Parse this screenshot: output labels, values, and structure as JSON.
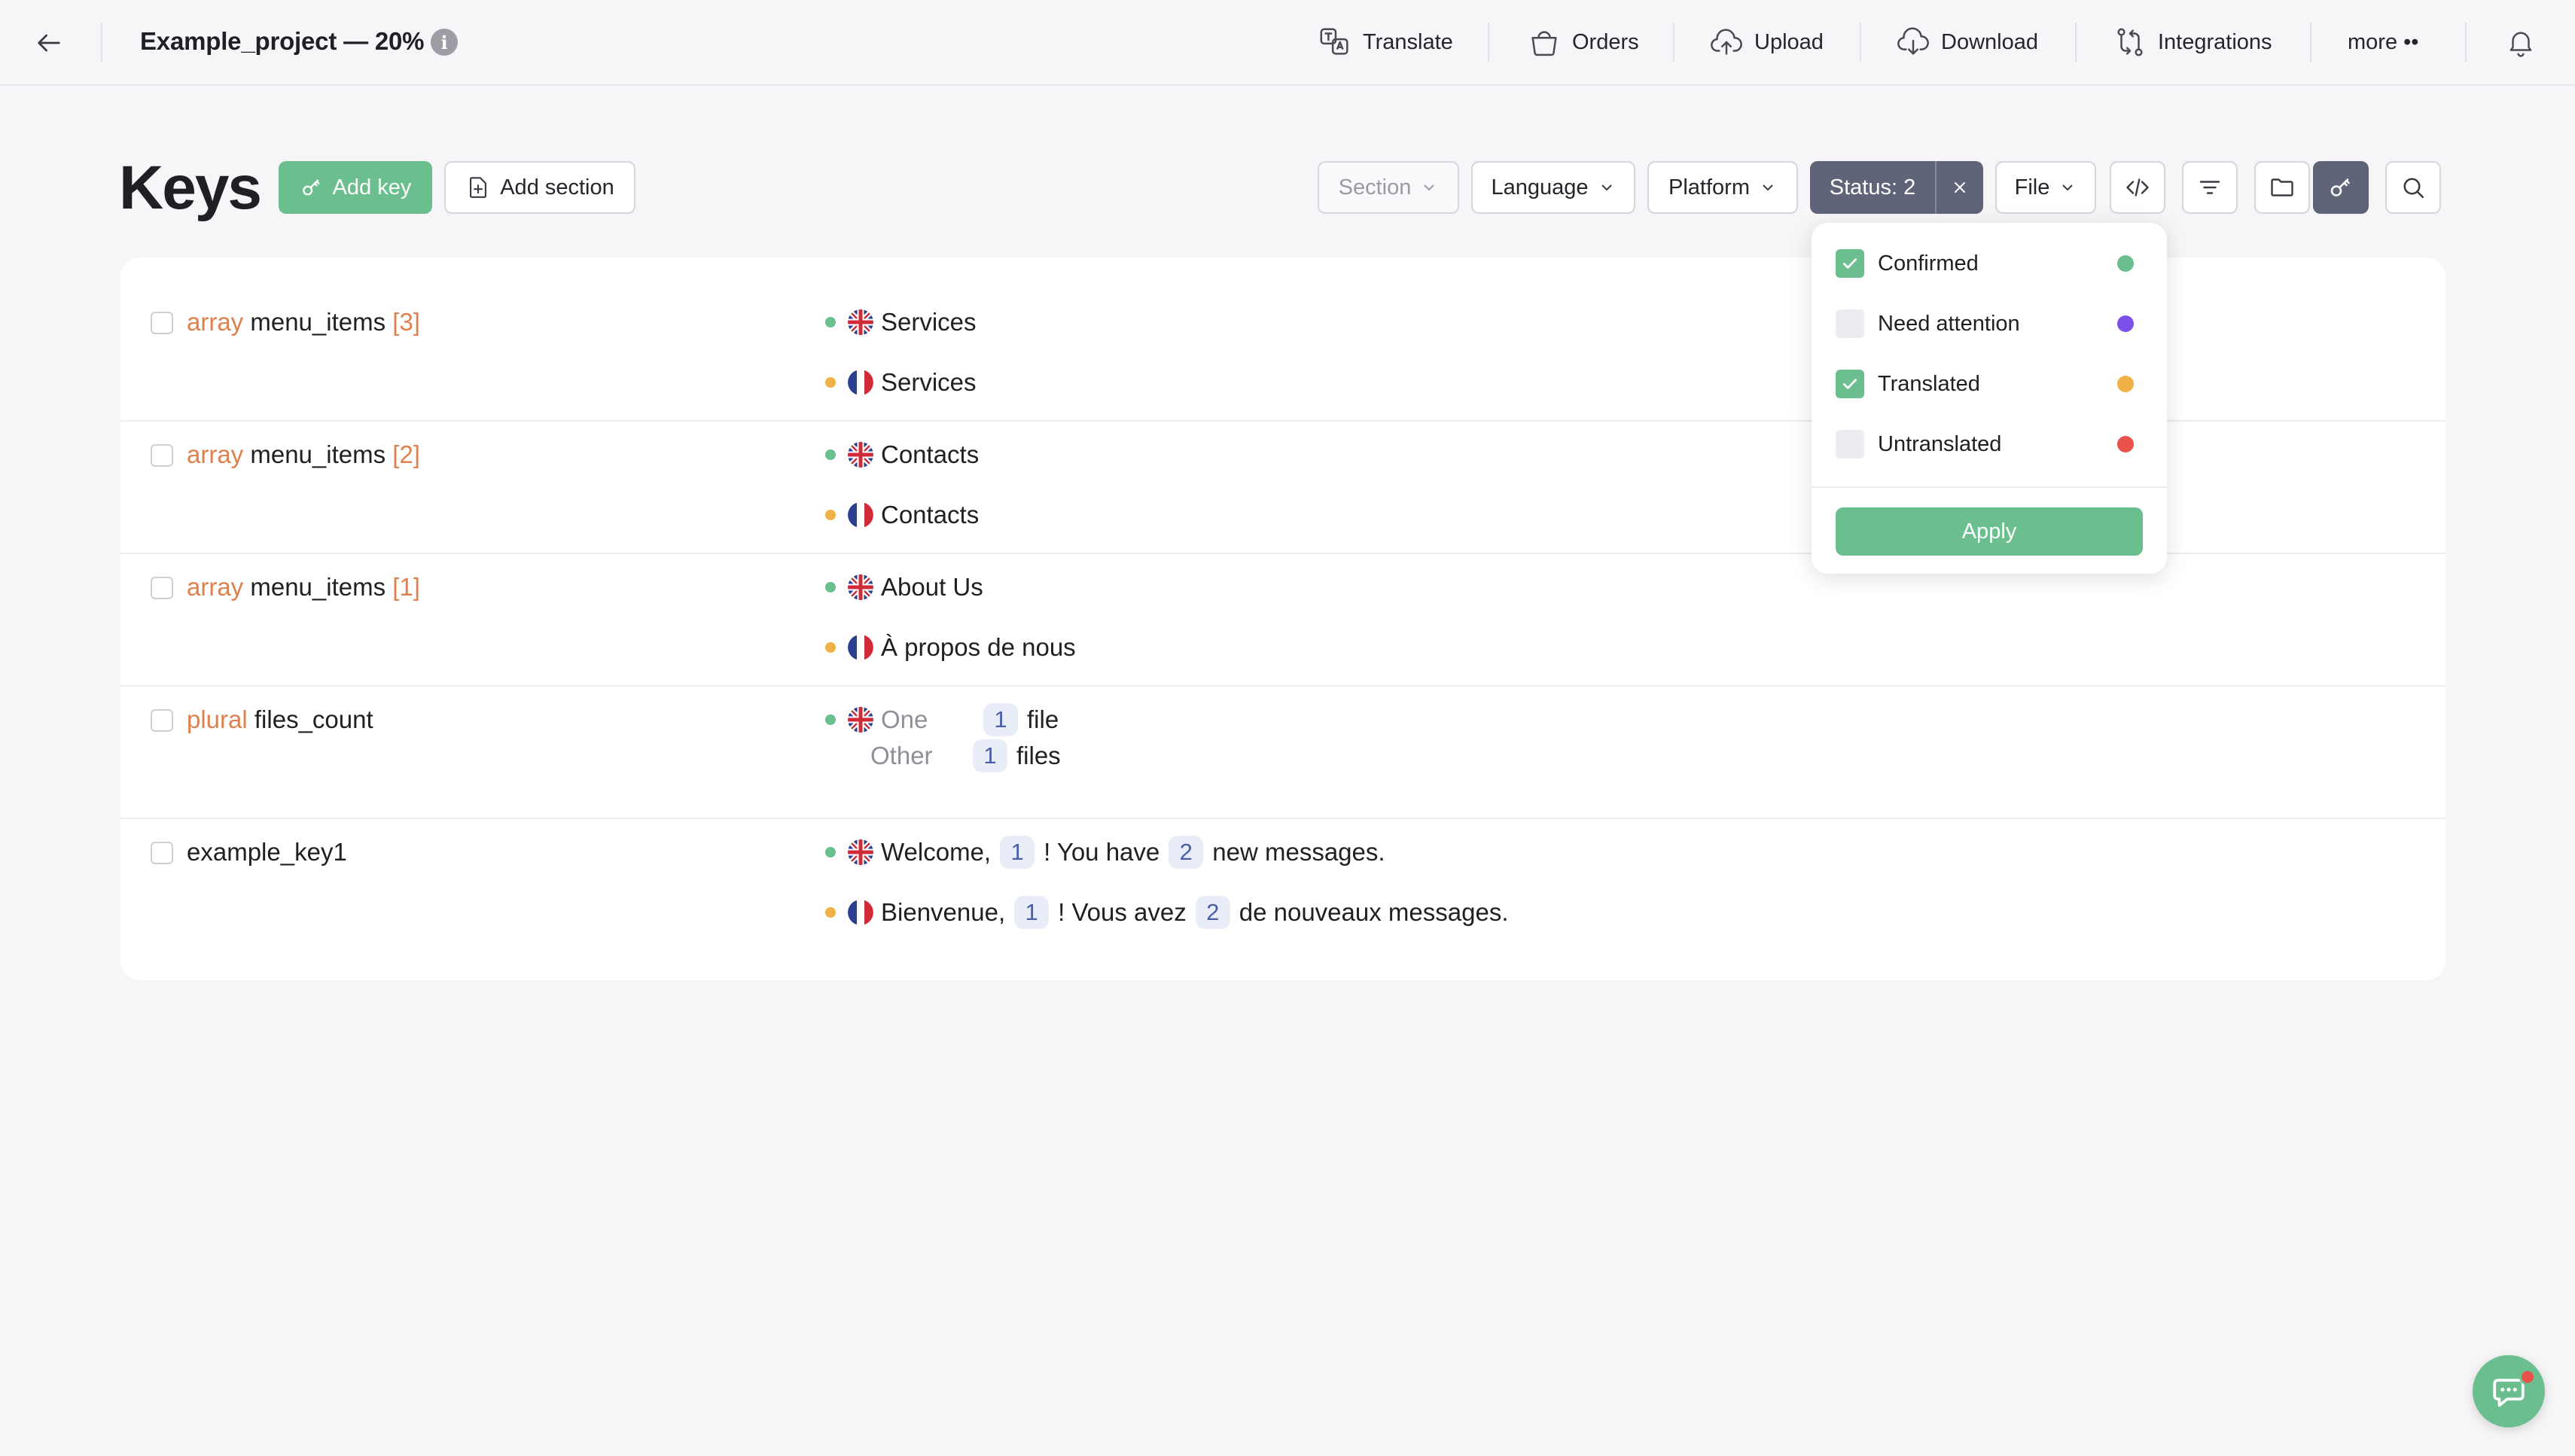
{
  "topbar": {
    "project_title": "Example_project — 20%",
    "info_glyph": "i",
    "nav": [
      {
        "label": "Translate",
        "icon": "translate-icon"
      },
      {
        "label": "Orders",
        "icon": "orders-icon"
      },
      {
        "label": "Upload",
        "icon": "upload-icon"
      },
      {
        "label": "Download",
        "icon": "download-icon"
      },
      {
        "label": "Integrations",
        "icon": "integrations-icon"
      },
      {
        "label": "more ••",
        "icon": "more-dots"
      }
    ]
  },
  "header": {
    "title": "Keys",
    "add_key_label": "Add key",
    "add_section_label": "Add section",
    "filters": {
      "section": "Section",
      "language": "Language",
      "platform": "Platform",
      "status": "Status: 2",
      "file": "File"
    }
  },
  "colors": {
    "accent_green": "#6bbf8e",
    "chip_dark": "#5f6478",
    "key_type_orange": "#e0804c",
    "status_confirmed": "#6bbf8e",
    "status_need_attention": "#7b4fe8",
    "status_translated": "#f0b245",
    "status_untranslated": "#e8524a"
  },
  "keys": [
    {
      "type": "array",
      "name": "menu_items",
      "index": "[3]",
      "en": "Services",
      "fr": "Services"
    },
    {
      "type": "array",
      "name": "menu_items",
      "index": "[2]",
      "en": "Contacts",
      "fr": "Contacts"
    },
    {
      "type": "array",
      "name": "menu_items",
      "index": "[1]",
      "en": "About Us",
      "fr": "À propos de nous"
    },
    {
      "type": "plural",
      "name": "files_count",
      "one_label": "One",
      "one_ph": "1",
      "one_text": "file",
      "other_label": "Other",
      "other_ph": "1",
      "other_text": "files"
    },
    {
      "name": "example_key1",
      "en": {
        "a": "Welcome,",
        "p1": "1",
        "b": "! You have",
        "p2": "2",
        "c": "new messages."
      },
      "fr": {
        "a": "Bienvenue,",
        "p1": "1",
        "b": "! Vous avez",
        "p2": "2",
        "c": "de nouveaux messages."
      }
    }
  ],
  "status_dropdown": {
    "options": [
      {
        "label": "Confirmed",
        "checked": true
      },
      {
        "label": "Need attention",
        "checked": false
      },
      {
        "label": "Translated",
        "checked": true
      },
      {
        "label": "Untranslated",
        "checked": false
      }
    ],
    "apply_label": "Apply"
  }
}
